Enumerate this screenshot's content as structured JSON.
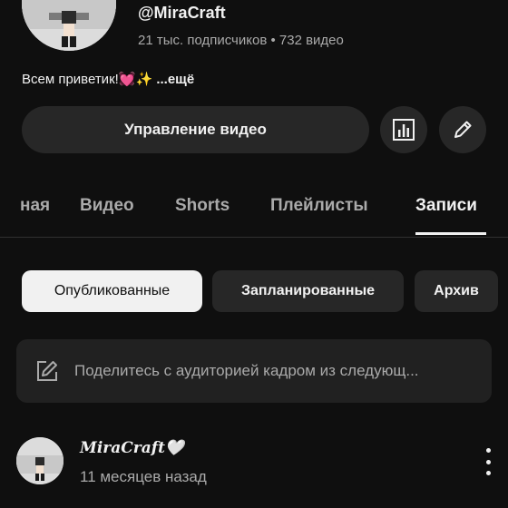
{
  "channel": {
    "handle": "@MiraCraft",
    "stats": "21 тыс. подписчиков • 732 видео",
    "description": "Всем приветик!💓✨",
    "more_label": " ...ещё"
  },
  "actions": {
    "manage_label": "Управление видео",
    "stats_icon": "bar-chart-icon",
    "edit_icon": "pencil-icon"
  },
  "tabs": [
    {
      "label": "ная",
      "active": false
    },
    {
      "label": "Видео",
      "active": false
    },
    {
      "label": "Shorts",
      "active": false
    },
    {
      "label": "Плейлисты",
      "active": false
    },
    {
      "label": "Записи",
      "active": true
    }
  ],
  "filters": [
    {
      "label": "Опубликованные",
      "selected": true
    },
    {
      "label": "Запланированные",
      "selected": false
    },
    {
      "label": "Архив",
      "selected": false
    }
  ],
  "composer": {
    "placeholder": "Поделитесь с аудиторией кадром из следующ..."
  },
  "post": {
    "author": "MiraCraft🤍",
    "time": "11 месяцев назад"
  },
  "colors": {
    "background": "#0f0f0f",
    "surface": "#272727",
    "text": "#f1f1f1",
    "muted": "#aaaaaa"
  }
}
